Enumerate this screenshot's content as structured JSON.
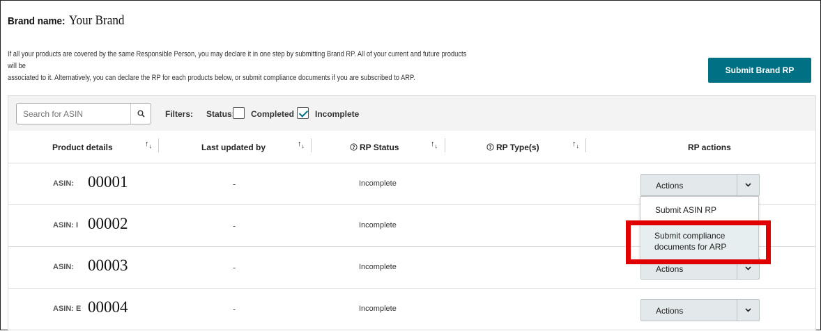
{
  "brand": {
    "label": "Brand name:",
    "value": "Your Brand"
  },
  "description": {
    "line1": "If all your products are covered by the same Responsible Person, you may declare it in one step by submitting Brand RP. All of your current and future products will be",
    "line2": "associated to it. Alternatively, you can declare the RP for each products below, or submit compliance documents if you are subscribed to ARP."
  },
  "submit_brand_rp": "Submit Brand RP",
  "filters": {
    "search_placeholder": "Search for ASIN",
    "filters_label": "Filters:",
    "status_label": "Status:",
    "completed": {
      "label": "Completed",
      "checked": false
    },
    "incomplete": {
      "label": "Incomplete",
      "checked": true
    }
  },
  "table": {
    "headers": {
      "product_details": "Product details",
      "last_updated_by": "Last updated by",
      "rp_status": "RP Status",
      "rp_types": "RP Type(s)",
      "rp_actions": "RP actions"
    },
    "rows": [
      {
        "asin_label": "ASIN:",
        "asin": "00001",
        "last_updated_by": "-",
        "rp_status": "Incomplete",
        "action": "Actions"
      },
      {
        "asin_label": "ASIN: I",
        "asin": "00002",
        "last_updated_by": "-",
        "rp_status": "Incomplete",
        "action": ""
      },
      {
        "asin_label": "ASIN:",
        "asin": "00003",
        "last_updated_by": "-",
        "rp_status": "Incomplete",
        "action": "Actions"
      },
      {
        "asin_label": "ASIN: E",
        "asin": "00004",
        "last_updated_by": "-",
        "rp_status": "Incomplete",
        "action": "Actions"
      }
    ]
  },
  "dropdown": {
    "items": [
      "Submit ASIN RP",
      "Submit compliance documents for ARP"
    ]
  },
  "icons": {
    "search": "search-icon",
    "sort": "sort-icon",
    "help": "help-circle-icon",
    "chevron": "chevron-down-icon"
  },
  "colors": {
    "accent": "#007185",
    "highlight": "#e00000",
    "actions_bg": "#e3e8ea"
  }
}
